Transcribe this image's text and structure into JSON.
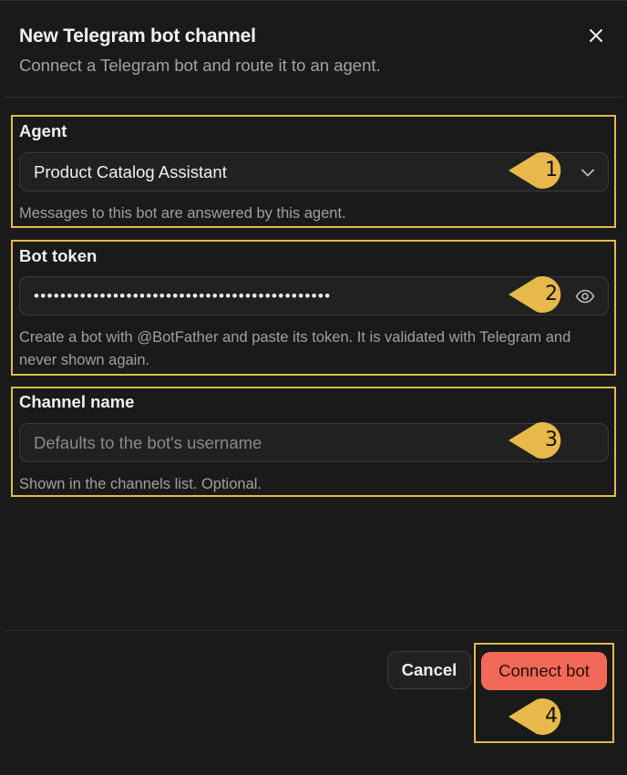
{
  "dialog": {
    "title": "New Telegram bot channel",
    "subtitle": "Connect a Telegram bot and route it to an agent.",
    "close_icon": "close-icon"
  },
  "fields": {
    "agent": {
      "label": "Agent",
      "value": "Product Catalog Assistant",
      "help": "Messages to this bot are answered by this agent.",
      "icon": "chevron-down-icon",
      "marker": "1"
    },
    "bot_token": {
      "label": "Bot token",
      "value": "•••••••••••••••••••••••••••••••••••••••••••••",
      "help": "Create a bot with @BotFather and paste its token. It is validated with Telegram and never shown again.",
      "icon": "eye-icon",
      "marker": "2"
    },
    "channel_name": {
      "label": "Channel name",
      "placeholder": "Defaults to the bot's username",
      "help": "Shown in the channels list. Optional.",
      "marker": "3"
    }
  },
  "footer": {
    "cancel_label": "Cancel",
    "connect_label": "Connect bot",
    "marker": "4"
  },
  "colors": {
    "background": "#1a1a1a",
    "highlight": "#e6b94a",
    "primary_button": "#f26a57",
    "marker_fill": "#e6b94a"
  }
}
